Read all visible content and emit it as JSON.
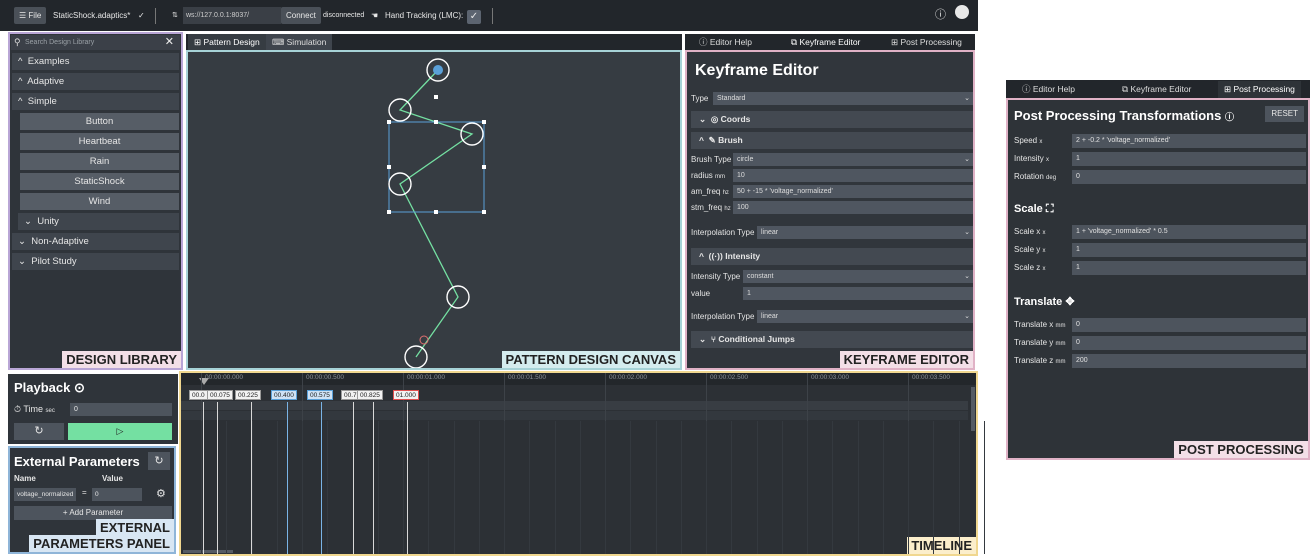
{
  "topbar": {
    "file_label": "File",
    "filename": "StaticShock.adaptics*",
    "ws_url": "ws://127.0.0.1:8037/",
    "connect_label": "Connect",
    "status": "disconnected",
    "hand_tracking_label": "Hand Tracking (LMC):"
  },
  "library": {
    "search_placeholder": "Search Design Library",
    "groups": [
      {
        "label": "Examples"
      },
      {
        "label": "Adaptive"
      },
      {
        "label": "Simple"
      }
    ],
    "simple_items": [
      "Button",
      "Heartbeat",
      "Rain",
      "StaticShock",
      "Wind"
    ],
    "bottom_groups": [
      {
        "label": "Unity"
      },
      {
        "label": "Non-Adaptive"
      },
      {
        "label": "Pilot Study"
      }
    ],
    "zone_label": "DESIGN LIBRARY"
  },
  "canvas": {
    "tabs": [
      "Pattern Design",
      "Simulation"
    ],
    "zone_label": "PATTERN DESIGN CANVAS"
  },
  "right_tabs": [
    "Editor Help",
    "Keyframe Editor",
    "Post Processing"
  ],
  "keyframe": {
    "title": "Keyframe Editor",
    "type_label": "Type",
    "type_value": "Standard",
    "sections": {
      "coords": "Coords",
      "brush": "Brush",
      "intensity": "Intensity",
      "jumps": "Conditional Jumps"
    },
    "brush_type_label": "Brush Type",
    "brush_type_value": "circle",
    "radius_label": "radius",
    "radius_unit": "mm",
    "radius_value": "10",
    "am_freq_label": "am_freq",
    "am_freq_unit": "hz",
    "am_freq_value": "50 + -15 * 'voltage_normalized'",
    "stm_freq_label": "stm_freq",
    "stm_freq_unit": "hz",
    "stm_freq_value": "100",
    "interp_label": "Interpolation Type",
    "interp_value": "linear",
    "intensity_type_label": "Intensity Type",
    "intensity_type_value": "constant",
    "value_label": "value",
    "value_value": "1",
    "interp2_label": "Interpolation Type",
    "interp2_value": "linear",
    "zone_label": "KEYFRAME EDITOR"
  },
  "playback": {
    "title": "Playback",
    "time_label": "Time",
    "time_unit": "sec",
    "time_value": "0"
  },
  "external": {
    "title": "External Parameters",
    "col_name": "Name",
    "col_value": "Value",
    "param_name": "voltage_normalized",
    "param_value": "0",
    "add_label": "+ Add Parameter",
    "zone_label_1": "EXTERNAL",
    "zone_label_2": "PARAMETERS PANEL"
  },
  "timeline": {
    "ticks": [
      "00:00:00.000",
      "00:00:00.500",
      "00:00:01.000",
      "00:00:01.500",
      "00:00:02.000",
      "00:00:02.500",
      "00:00:03.000",
      "00:00:03.500"
    ],
    "keyframes": [
      "00.0",
      "00.075",
      "00.225",
      "00.400",
      "00.575",
      "00.7",
      "00.825",
      "01.000"
    ],
    "zone_label": "TIMELINE"
  },
  "post": {
    "tabs": [
      "Editor Help",
      "Keyframe Editor",
      "Post Processing"
    ],
    "title": "Post Processing Transformations",
    "reset": "RESET",
    "speed_label": "Speed",
    "speed_unit": "x",
    "speed_value": "2 + -0.2 * 'voltage_normalized'",
    "intensity_label": "Intensity",
    "intensity_unit": "x",
    "intensity_value": "1",
    "rotation_label": "Rotation",
    "rotation_unit": "deg",
    "rotation_value": "0",
    "scale_title": "Scale",
    "scale_x_label": "Scale x",
    "scale_x_unit": "x",
    "scale_x_value": "1 + 'voltage_normalized' * 0.5",
    "scale_y_label": "Scale y",
    "scale_y_unit": "x",
    "scale_y_value": "1",
    "scale_z_label": "Scale z",
    "scale_z_unit": "x",
    "scale_z_value": "1",
    "translate_title": "Translate",
    "tx_label": "Translate x",
    "tx_unit": "mm",
    "tx_value": "0",
    "ty_label": "Translate y",
    "ty_unit": "mm",
    "ty_value": "0",
    "tz_label": "Translate z",
    "tz_unit": "mm",
    "tz_value": "200",
    "zone_label": "POST PROCESSING"
  },
  "colors": {
    "accent_green": "#74e0a2",
    "zone_purple": "#b9a6d6",
    "zone_teal": "#a7d3d7",
    "zone_pink": "#e0b2c6",
    "zone_yellow": "#f0d78f",
    "zone_blue": "#8fb5d8"
  }
}
